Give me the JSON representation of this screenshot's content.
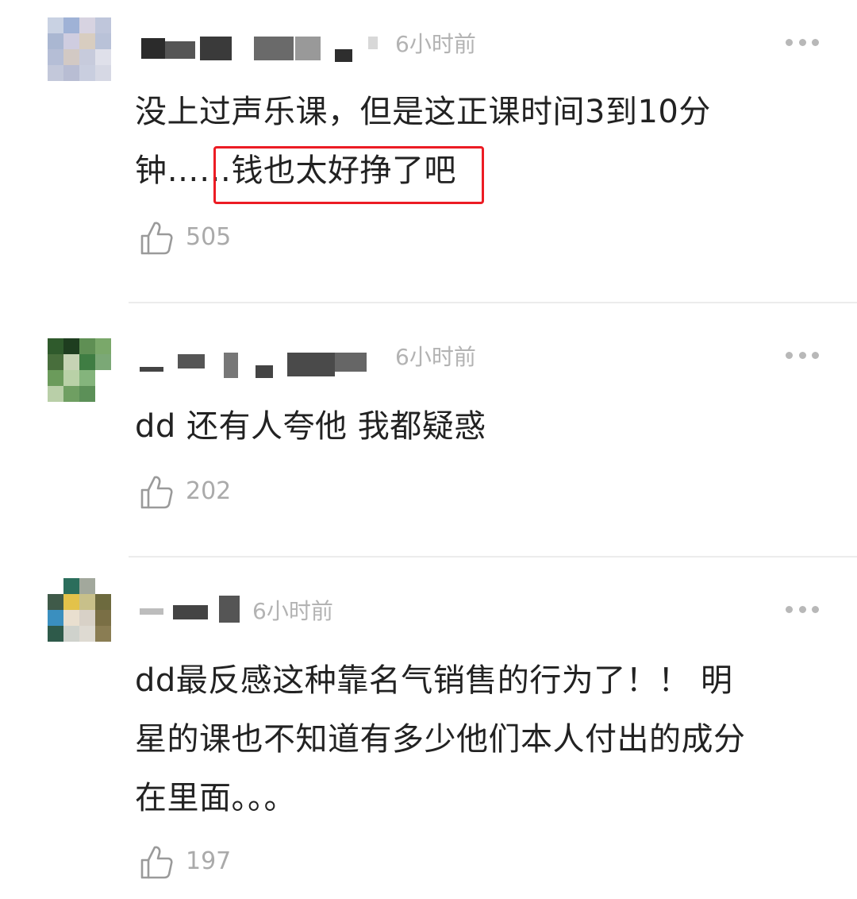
{
  "comments": [
    {
      "time": "6小时前",
      "line1": "没上过声乐课，但是这正课时间3到10分",
      "line2": "钟……钱也太好挣了吧",
      "likes": "505"
    },
    {
      "time": "6小时前",
      "line1": "dd 还有人夸他 我都疑惑",
      "likes": "202"
    },
    {
      "time": "6小时前",
      "line1": "dd最反感这种靠名气销售的行为了！！ 明",
      "line2": "星的课也不知道有多少他们本人付出的成分",
      "line3": "在里面。。。",
      "likes": "197"
    }
  ],
  "icons": {
    "like": "thumbs-up-icon",
    "more": "more-dots-icon"
  },
  "colors": {
    "highlight_box": "#ec1c24",
    "meta_text": "#b3b3b3",
    "body_text": "#222222"
  }
}
